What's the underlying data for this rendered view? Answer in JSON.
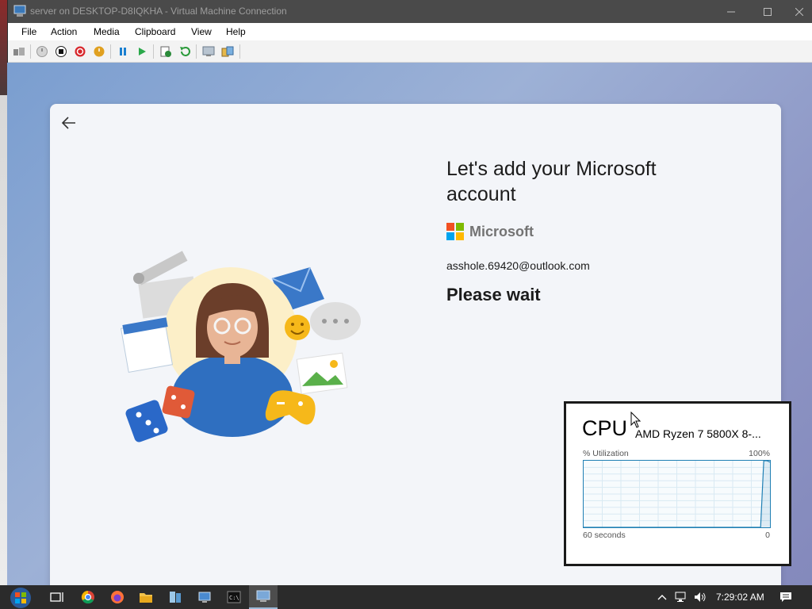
{
  "window": {
    "title": "server on DESKTOP-D8IQKHA - Virtual Machine Connection"
  },
  "menu": {
    "items": [
      "File",
      "Action",
      "Media",
      "Clipboard",
      "View",
      "Help"
    ]
  },
  "oobe": {
    "heading": "Let's add your Microsoft account",
    "brand": "Microsoft",
    "email": "asshole.69420@outlook.com",
    "status": "Please wait"
  },
  "cpu_widget": {
    "title": "CPU",
    "model": "AMD Ryzen 7 5800X 8-...",
    "util_label": "% Utilization",
    "util_max": "100%",
    "time_label": "60 seconds",
    "time_min": "0"
  },
  "chart_data": {
    "type": "line",
    "title": "",
    "xlabel": "",
    "ylabel": "",
    "ylim": [
      0,
      100
    ],
    "xlim": [
      60,
      0
    ],
    "series": [
      {
        "x": [
          60,
          50,
          40,
          30,
          20,
          10,
          3,
          2,
          1,
          0
        ],
        "values": [
          0,
          0,
          0,
          0,
          0,
          0,
          0,
          100,
          100,
          98
        ]
      }
    ]
  },
  "taskbar": {
    "clock": "7:29:02 AM"
  },
  "colors": {
    "titlebar": "#4a4a4a",
    "guest_bg": "#8f98c6",
    "graph_line": "#1f7fb4",
    "ms_red": "#f25022",
    "ms_green": "#7fba00",
    "ms_blue": "#00a4ef",
    "ms_yellow": "#ffb900"
  }
}
